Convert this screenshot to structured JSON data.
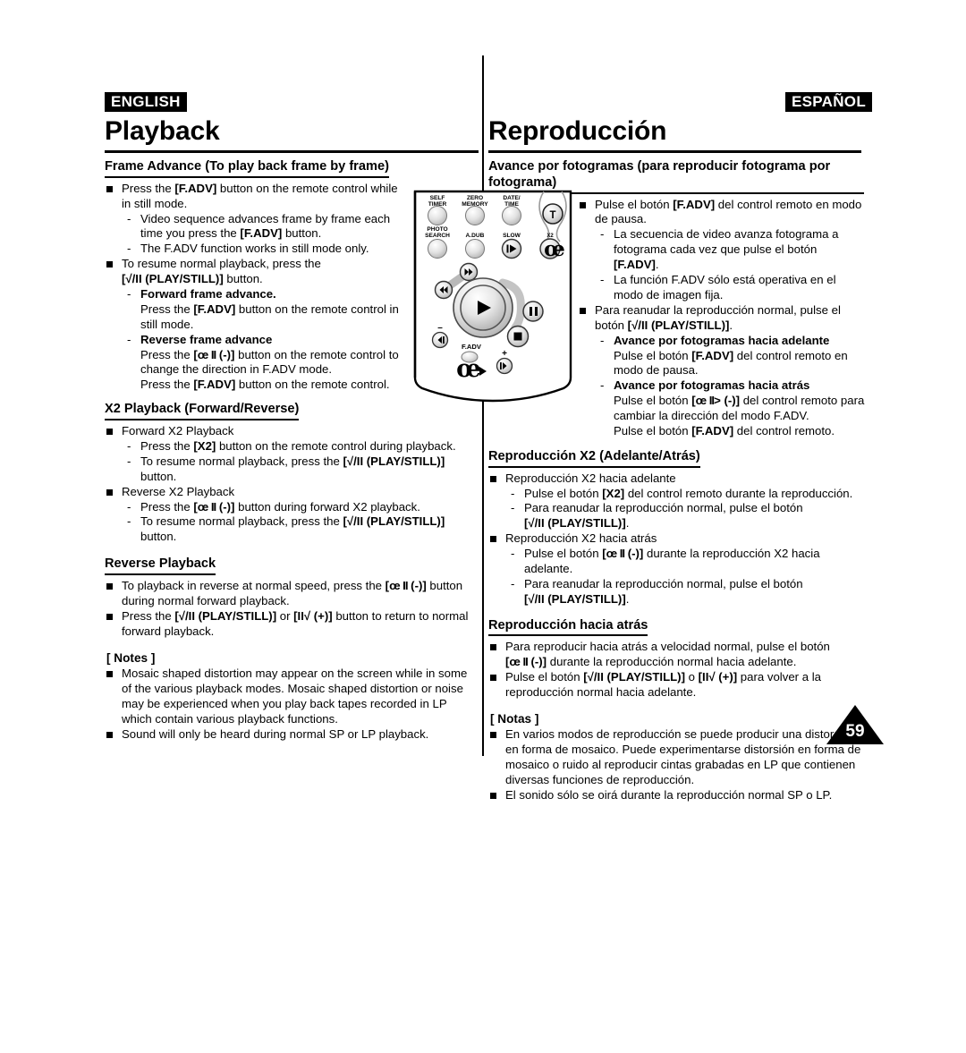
{
  "page": {
    "number": "59",
    "background": "#ffffff",
    "ink": "#000000"
  },
  "english": {
    "lang_tag": "ENGLISH",
    "title": "Playback",
    "sections": [
      {
        "heading": "Frame Advance (To play back frame by frame)",
        "items": [
          {
            "bullet": "Press the [F.ADV] button on the remote control while in still mode.",
            "bullet_parts": [
              "Press the ",
              "[F.ADV]",
              " button on the remote control while in still mode."
            ],
            "subs": [
              "Video sequence advances frame by frame each time you press the [F.ADV] button.",
              "The F.ADV function works in still mode only."
            ]
          },
          {
            "bullet": "To resume normal playback, press the [√/II (PLAY/STILL)] button.",
            "subs_bold": [
              {
                "label": "Forward frame advance.",
                "text": "Press the [F.ADV] button on the remote control in still mode."
              },
              {
                "label": "Reverse frame advance",
                "text": "Press the [œ II (-)] button on the remote control to change the direction in F.ADV mode.",
                "text2": "Press the [F.ADV] button on the remote control."
              }
            ]
          }
        ]
      },
      {
        "heading": "X2 Playback (Forward/Reverse)",
        "items": [
          {
            "bullet": "Forward X2 Playback",
            "subs": [
              "Press the [X2] button on the remote control during playback.",
              "To resume normal playback, press the [√/II (PLAY/STILL)] button."
            ]
          },
          {
            "bullet": "Reverse X2 Playback",
            "subs": [
              "Press the [œ II (-)] button during forward X2 playback.",
              "To resume normal playback, press the [√/II (PLAY/STILL)] button."
            ]
          }
        ]
      },
      {
        "heading": "Reverse Playback",
        "items": [
          {
            "bullet": "To playback in reverse at normal speed, press the [œ II (-)] button during normal forward playback."
          },
          {
            "bullet": "Press the [√/II (PLAY/STILL)] or [II√ (+)] button to return to normal forward playback."
          }
        ]
      }
    ],
    "notes_header": "[ Notes ]",
    "notes": [
      "Mosaic shaped distortion may appear on the screen while in some of the various playback modes. Mosaic shaped distortion or noise may be experienced when you play back tapes recorded in LP which contain various playback functions.",
      "Sound will only be heard during normal SP or LP playback."
    ]
  },
  "spanish": {
    "lang_tag": "ESPAÑOL",
    "title": "Reproducción",
    "sections": [
      {
        "heading": "Avance por fotogramas (para reproducir fotograma por fotograma)",
        "items": [
          {
            "bullet": "Pulse el botón [F.ADV] del control remoto en modo de pausa.",
            "subs": [
              "La secuencia de video avanza fotograma a fotograma cada vez que pulse el botón [F.ADV].",
              "La función F.ADV sólo está operativa en el modo de imagen fija."
            ]
          },
          {
            "bullet": "Para reanudar la reproducción normal, pulse el botón [√/II (PLAY/STILL)].",
            "subs_bold": [
              {
                "label": "Avance por fotogramas hacia adelante",
                "text": "Pulse el botón [F.ADV] del control remoto en modo de pausa."
              },
              {
                "label": "Avance por fotogramas hacia atrás",
                "text": "Pulse el botón [œ II> (-)] del control remoto para cambiar la dirección del modo F.ADV.",
                "text2": "Pulse el botón [F.ADV] del control remoto."
              }
            ]
          }
        ]
      },
      {
        "heading": "Reproducción X2 (Adelante/Atrás)",
        "items": [
          {
            "bullet": "Reproducción X2 hacia adelante",
            "subs": [
              "Pulse el botón [X2] del control remoto durante la reproducción.",
              "Para reanudar la reproducción normal, pulse el botón [√/II (PLAY/STILL)]."
            ]
          },
          {
            "bullet": "Reproducción X2 hacia atrás",
            "subs": [
              "Pulse el botón [œ II (-)] durante la reproducción X2 hacia adelante.",
              "Para reanudar la reproducción normal, pulse el botón [√/II (PLAY/STILL)]."
            ]
          }
        ]
      },
      {
        "heading": "Reproducción hacia atrás",
        "items": [
          {
            "bullet": "Para reproducir hacia atrás a velocidad normal, pulse el botón [œ II (-)] durante la reproducción normal hacia adelante."
          },
          {
            "bullet": "Pulse el botón [√/II (PLAY/STILL)] o [II√ (+)] para volver a la reproducción normal hacia adelante."
          }
        ]
      }
    ],
    "notes_header": "[ Notas ]",
    "notes": [
      "En varios modos de reproducción se puede producir una distorsión en forma de mosaico. Puede experimentarse distorsión en forma de mosaico o ruido al reproducir cintas grabadas en LP que contienen diversas funciones de reproducción.",
      "El sonido sólo se oirá durante la reproducción normal SP o LP."
    ]
  },
  "remote": {
    "labels": {
      "self_timer_line1": "SELF",
      "self_timer_line2": "TIMER",
      "zero_memory_line1": "ZERO",
      "zero_memory_line2": "MEMORY",
      "date_time_line1": "DATE/",
      "date_time_line2": "TIME",
      "photo_search_line1": "PHOTO",
      "photo_search_line2": "SEARCH",
      "a_dub": "A.DUB",
      "slow": "SLOW",
      "x2": "X2",
      "zoom_t": "T",
      "f_adv": "F.ADV",
      "vol_minus": "–",
      "vol_plus": "+"
    }
  }
}
